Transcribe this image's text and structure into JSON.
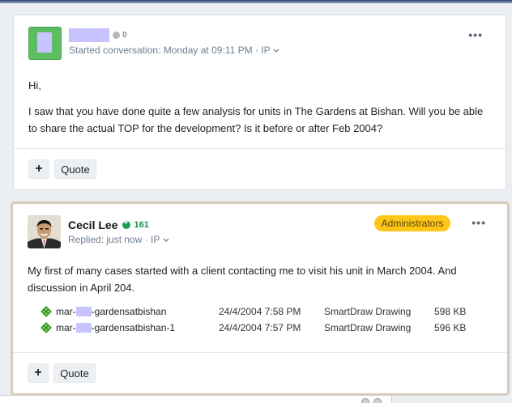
{
  "post1": {
    "score": "0",
    "meta_text": "Started conversation: Monday at 09:11 PM · IP",
    "paragraphs": [
      "Hi,",
      "I saw that you have done quite a few analysis for units in The Gardens at Bishan. Will you be able to share the actual TOP for the development? Is it before or after Feb 2004?"
    ],
    "plus_label": "+",
    "quote_label": "Quote",
    "more_label": "•••"
  },
  "post2": {
    "author": "Cecil Lee",
    "score": "161",
    "meta_text": "Replied: just now · IP",
    "badge": "Administrators",
    "paragraph": "My first of many cases started with a client contacting me to visit his unit in March 2004. And discussion in April 204.",
    "attachments": [
      {
        "name_prefix": "mar-",
        "name_suffix": "-gardensatbishan",
        "date": "24/4/2004 7:58 PM",
        "type": "SmartDraw Drawing",
        "size": "598 KB"
      },
      {
        "name_prefix": "mar-",
        "name_suffix": "-gardensatbishan-1",
        "date": "24/4/2004 7:57 PM",
        "type": "SmartDraw Drawing",
        "size": "596 KB"
      }
    ],
    "plus_label": "+",
    "quote_label": "Quote",
    "more_label": "•••"
  },
  "colors": {
    "badge": "#ffc61a",
    "score_green": "#1c8f46",
    "avatar_green": "#5cbd61",
    "redaction": "#c7c3ff"
  },
  "icons": [
    "chevron-down-icon",
    "more-options-icon",
    "smartdraw-file-icon",
    "reputation-icon"
  ]
}
